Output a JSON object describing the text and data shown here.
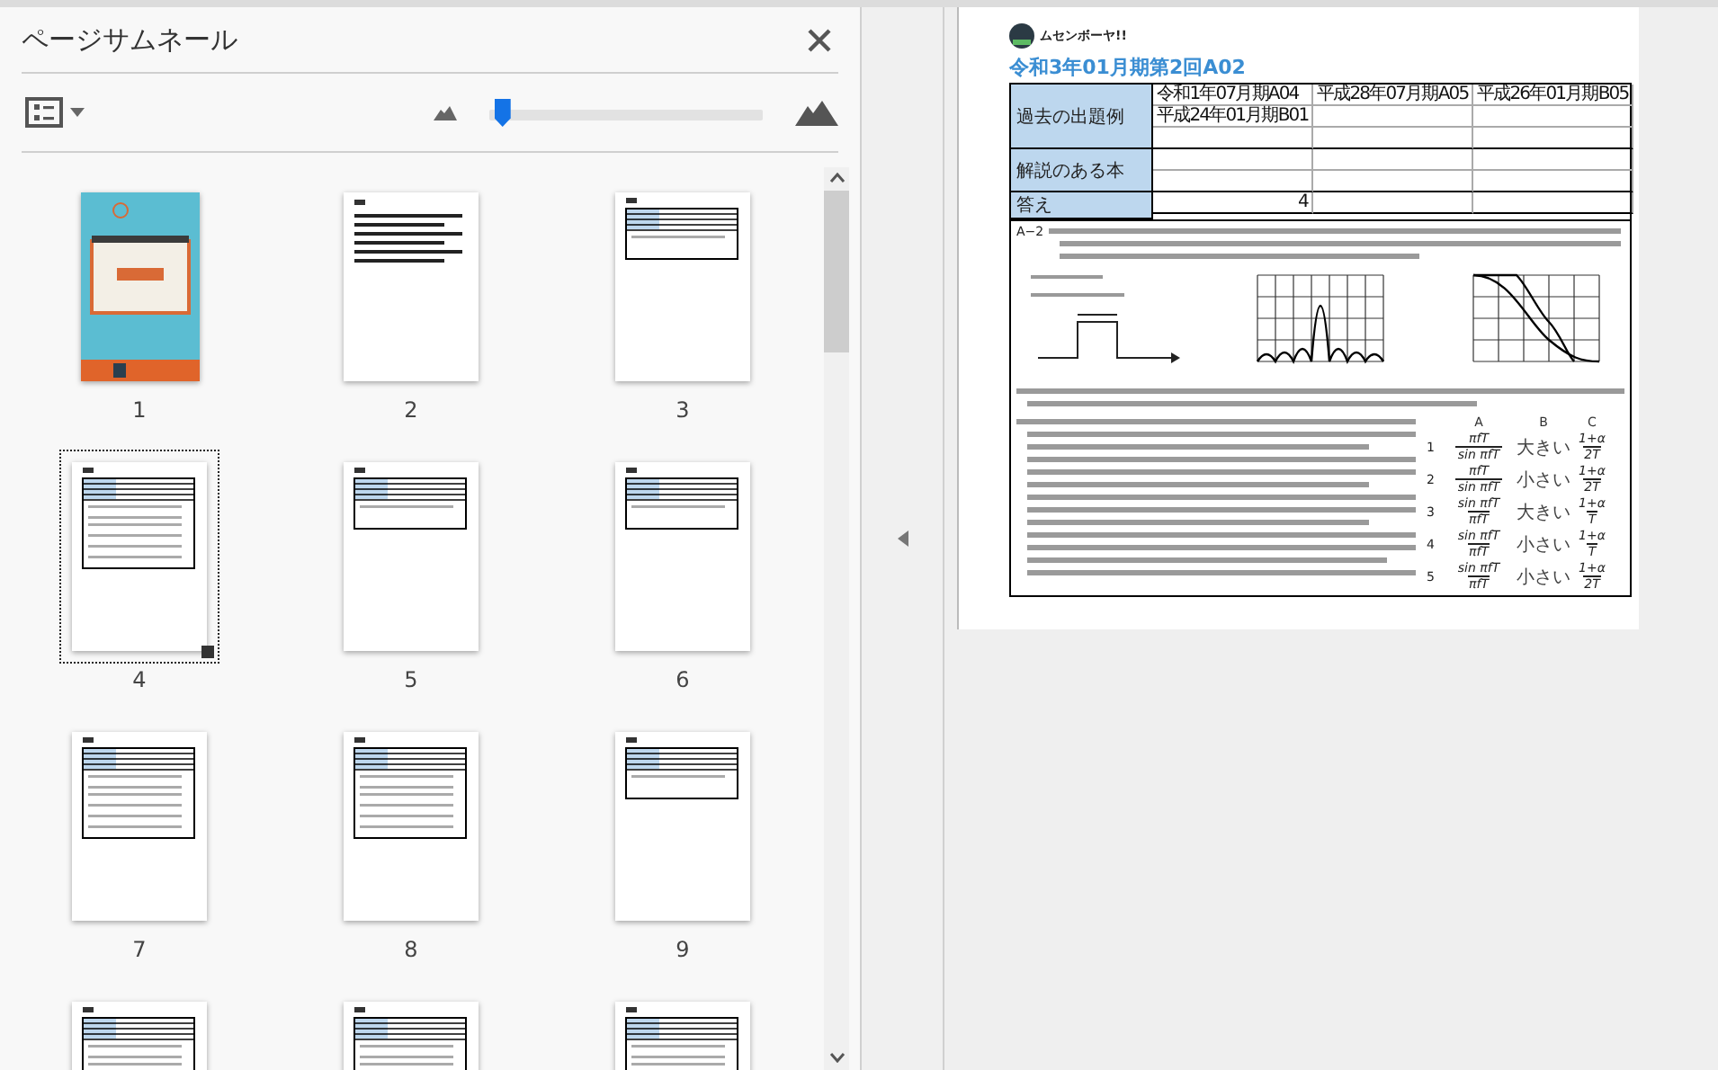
{
  "panel": {
    "title": "ページサムネール",
    "zoom": {
      "level": 0.02
    }
  },
  "thumbnails": [
    {
      "label": "1",
      "kind": "cover",
      "selected": false
    },
    {
      "label": "2",
      "kind": "text",
      "selected": false
    },
    {
      "label": "3",
      "kind": "table",
      "selected": false
    },
    {
      "label": "4",
      "kind": "problem",
      "selected": true
    },
    {
      "label": "5",
      "kind": "table",
      "selected": false
    },
    {
      "label": "6",
      "kind": "table",
      "selected": false
    },
    {
      "label": "7",
      "kind": "problem",
      "selected": false
    },
    {
      "label": "8",
      "kind": "problem",
      "selected": false
    },
    {
      "label": "9",
      "kind": "table",
      "selected": false
    },
    {
      "kind": "problem",
      "selected": false
    },
    {
      "kind": "problem",
      "selected": false
    },
    {
      "kind": "problem",
      "selected": false
    }
  ],
  "document": {
    "logo_text": "ムセンボーヤ!!",
    "title": "令和3年01月期第2回A02",
    "info_table": [
      {
        "kind": "history",
        "heading": "過去の出題例",
        "entries": [
          "令和1年07月期A04",
          "平成28年07月期A05",
          "平成26年01月期B05",
          "平成24年01月期B01"
        ]
      },
      {
        "kind": "books",
        "heading": "解説のある本"
      },
      {
        "kind": "answer",
        "heading": "答え",
        "entries": [
          "4"
        ]
      }
    ],
    "problem": {
      "label": "A−2",
      "options": {
        "headings": [
          "A",
          "B",
          "C"
        ],
        "rows": [
          {
            "number": "1",
            "a_num": "πfT",
            "a_den": "sin πfT",
            "b": "大きい",
            "c_num": "1+α",
            "c_den": "2T"
          },
          {
            "number": "2",
            "a_num": "πfT",
            "a_den": "sin πfT",
            "b": "小さい",
            "c_num": "1+α",
            "c_den": "2T"
          },
          {
            "number": "3",
            "a_num": "sin πfT",
            "a_den": "πfT",
            "b": "大きい",
            "c_num": "1+α",
            "c_den": "T"
          },
          {
            "number": "4",
            "a_num": "sin πfT",
            "a_den": "πfT",
            "b": "小さい",
            "c_num": "1+α",
            "c_den": "T"
          },
          {
            "number": "5",
            "a_num": "sin πfT",
            "a_den": "πfT",
            "b": "小さい",
            "c_num": "1+α",
            "c_den": "2T"
          }
        ]
      }
    }
  }
}
